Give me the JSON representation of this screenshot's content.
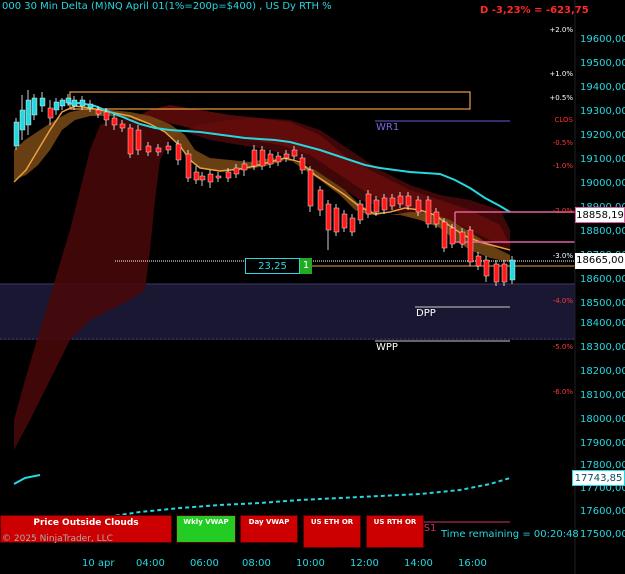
{
  "header": {
    "title": "000 30 Min Delta (M)NQ  April 01(1%=200p=$400) , US Dy RTH %",
    "delta_text": "D -3,23% = -623,75",
    "clos_label": "CLOS"
  },
  "price_axis": {
    "labels": [
      "19600,00",
      "19500,00",
      "19400,00",
      "19300,00",
      "19200,00",
      "19100,00",
      "19000,00",
      "18900,00",
      "18800,00",
      "18700,00",
      "18600,00",
      "18500,00",
      "18400,00",
      "18300,00",
      "18200,00",
      "18100,00",
      "18000,00",
      "17900,00",
      "17800,00",
      "17700,00",
      "17600,00",
      "17500,00"
    ],
    "pct_labels": [
      "+2.0%",
      "+1.0%",
      "+0.5%",
      "CLOS",
      "-0.5%",
      "-1.0%",
      "-2.0%",
      "-3.0%",
      "-4.0%",
      "-5.0%",
      "-6.0%"
    ],
    "highlight_top": "18858,19",
    "highlight_mid": "18665,00",
    "highlight_low": "17743,85"
  },
  "time_axis": {
    "labels": [
      "10 apr",
      "04:00",
      "06:00",
      "08:00",
      "10:00",
      "12:00",
      "14:00",
      "16:00"
    ]
  },
  "levels": {
    "wr1": "WR1",
    "dpp": "DPP",
    "wpp": "WPP",
    "ds1": "DS1"
  },
  "tags": {
    "value": "23,25",
    "count": "1"
  },
  "buttons": {
    "price_outside": "Price Outside Clouds",
    "wkly_vwap": "Wkly VWAP",
    "day_vwap": "Day VWAP",
    "us_eth_or": "US ETH OR",
    "us_rth_or": "US RTH OR"
  },
  "footer": {
    "copyright": "© 2025 NinjaTrader, LLC",
    "time_remaining": "Time remaining = 00:20:48"
  },
  "colors": {
    "background": "#000000",
    "cyan": "#27d7e0",
    "up_candle": "#27d7e0",
    "down_candle": "#ff1a1a",
    "cloud_dark": "#5a0a0a",
    "cloud_orange": "#8a5a1a",
    "ema_orange": "#e8a040",
    "pink": "#e060a0",
    "button_red": "#cc0000",
    "button_green": "#22cc22"
  }
}
